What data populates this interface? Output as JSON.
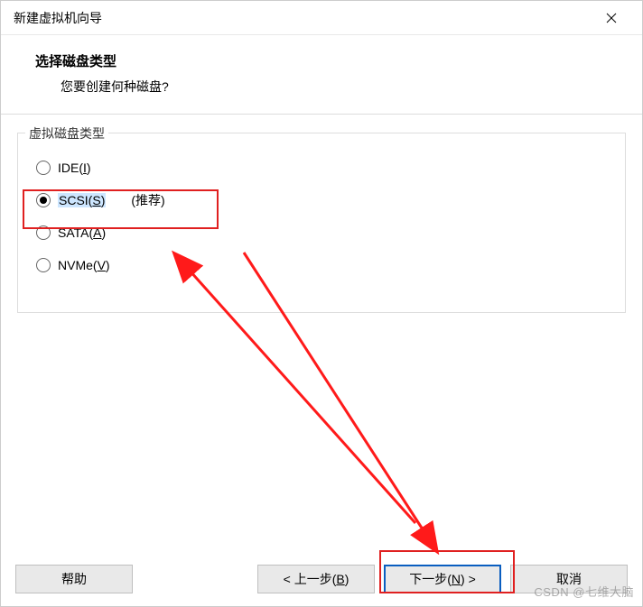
{
  "window": {
    "title": "新建虚拟机向导"
  },
  "header": {
    "title": "选择磁盘类型",
    "subtitle": "您要创建何种磁盘?"
  },
  "group": {
    "label": "虚拟磁盘类型"
  },
  "options": {
    "ide": {
      "prefix": "IDE(",
      "hotkey": "I",
      "suffix": ")"
    },
    "scsi": {
      "prefix": "SCSI(",
      "hotkey": "S",
      "suffix": ")",
      "recommend": "(推荐)"
    },
    "sata": {
      "prefix": "SATA(",
      "hotkey": "A",
      "suffix": ")"
    },
    "nvme": {
      "prefix": "NVMe(",
      "hotkey": "V",
      "suffix": ")"
    }
  },
  "buttons": {
    "help": "帮助",
    "back_prefix": "< 上一步(",
    "back_hotkey": "B",
    "back_suffix": ")",
    "next_prefix": "下一步(",
    "next_hotkey": "N",
    "next_suffix": ") >",
    "cancel": "取消"
  },
  "watermark": "CSDN @七维大脑"
}
